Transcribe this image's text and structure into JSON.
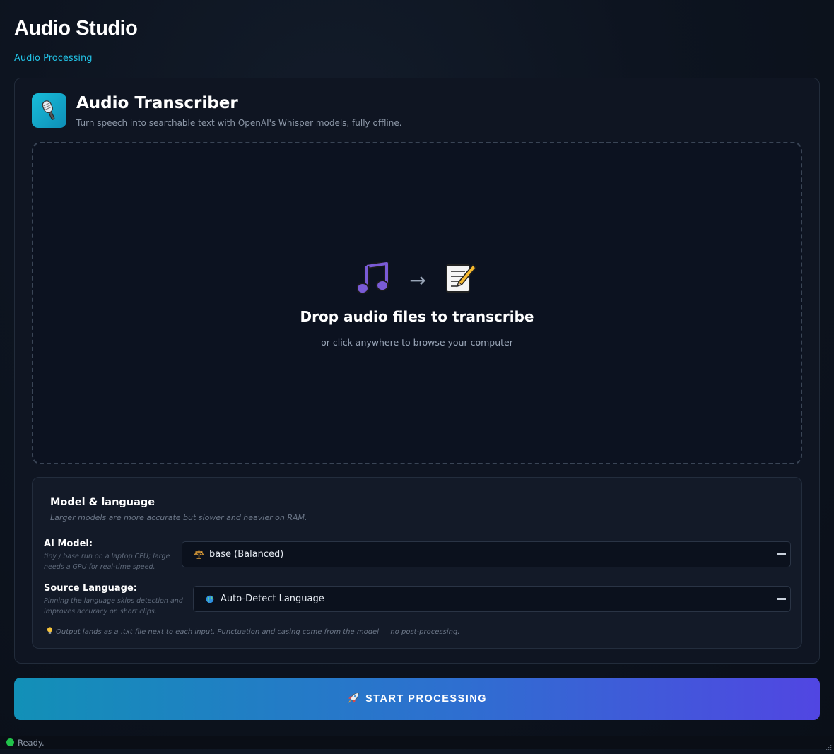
{
  "app": {
    "title": "Audio Studio",
    "section": "Audio Processing"
  },
  "tool": {
    "icon": "microphone-icon",
    "title": "Audio Transcriber",
    "description": "Turn speech into searchable text with OpenAI's Whisper models, fully offline."
  },
  "dropzone": {
    "icons": [
      "music-note-icon",
      "arrow-right-icon",
      "memo-icon"
    ],
    "arrow_glyph": "→",
    "title": "Drop audio files to transcribe",
    "subtitle": "or click anywhere to browse your computer"
  },
  "settings": {
    "title": "Model & language",
    "hint": "Larger models are more accurate but slower and heavier on RAM.",
    "model": {
      "label": "AI Model:",
      "help": "tiny / base run on a laptop CPU; large needs a GPU for real-time speed.",
      "icon": "balance-scale-icon",
      "value": "base (Balanced)"
    },
    "language": {
      "label": "Source Language:",
      "help": "Pinning the language skips detection and improves accuracy on short clips.",
      "icon": "globe-icon",
      "value": "Auto-Detect Language"
    },
    "tip": "Output lands as a .txt file next to each input. Punctuation and casing come from the model — no post-processing."
  },
  "start_button": {
    "icon": "rocket-icon",
    "label": "START PROCESSING"
  },
  "status": {
    "text": "Ready.",
    "color": "#21c24a"
  },
  "colors": {
    "accent": "#22c3e6",
    "button_start": "#1290b7",
    "button_end": "#5146e2"
  }
}
